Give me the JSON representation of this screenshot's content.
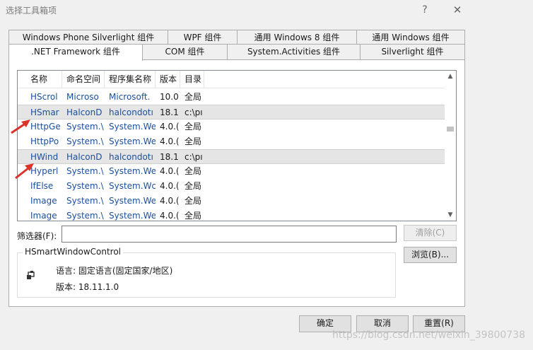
{
  "window": {
    "title": "选择工具箱项",
    "help_label": "?",
    "close_label": "✕"
  },
  "tabs": {
    "row1": [
      {
        "label": "Windows Phone Silverlight 组件"
      },
      {
        "label": "WPF 组件"
      },
      {
        "label": "通用 Windows 8 组件"
      },
      {
        "label": "通用 Windows 组件"
      }
    ],
    "row2": [
      {
        "label": ".NET Framework 组件",
        "active": true
      },
      {
        "label": "COM 组件"
      },
      {
        "label": "System.Activities 组件"
      },
      {
        "label": "Silverlight 组件"
      }
    ]
  },
  "list": {
    "columns": [
      "名称",
      "命名空间",
      "程序集名称",
      "版本",
      "目录"
    ],
    "rows": [
      {
        "name": "HScrol",
        "ns": "Microso",
        "asm": "Microsoft.",
        "ver": "10.0",
        "dir": "全局",
        "selected": false
      },
      {
        "name": "HSmar",
        "ns": "HalconD",
        "asm": "halcondotı",
        "ver": "18.1",
        "dir": "c:\\pı",
        "selected": true
      },
      {
        "name": "HttpGe",
        "ns": "System.\\",
        "asm": "System.We",
        "ver": "4.0.(",
        "dir": "全局",
        "selected": false
      },
      {
        "name": "HttpPo",
        "ns": "System.\\",
        "asm": "System.We",
        "ver": "4.0.(",
        "dir": "全局",
        "selected": false
      },
      {
        "name": "HWind",
        "ns": "HalconD",
        "asm": "halcondotı",
        "ver": "18.1",
        "dir": "c:\\pı",
        "selected": true
      },
      {
        "name": "Hyperl",
        "ns": "System.\\",
        "asm": "System.We",
        "ver": "4.0.(",
        "dir": "全局",
        "selected": false
      },
      {
        "name": "IfElse",
        "ns": "System.\\",
        "asm": "System.Wc",
        "ver": "4.0.(",
        "dir": "全局",
        "selected": false
      },
      {
        "name": "Image",
        "ns": "System.\\",
        "asm": "System.We",
        "ver": "4.0.(",
        "dir": "全局",
        "selected": false
      },
      {
        "name": "Image",
        "ns": "System.\\",
        "asm": "System.We",
        "ver": "4.0.(",
        "dir": "全局",
        "selected": false
      }
    ],
    "scroll_up_icon": "▲",
    "scroll_down_icon": "▼"
  },
  "filter": {
    "label": "筛选器(F):",
    "value": "",
    "clear_label": "清除(C)"
  },
  "details": {
    "group_title": "HSmartWindowControl",
    "language_line": "语言:  固定语言(固定国家/地区)",
    "version_line": "版本:  18.11.1.0",
    "browse_label": "浏览(B)..."
  },
  "footer": {
    "ok_label": "确定",
    "cancel_label": "取消",
    "reset_label": "重置(R)"
  },
  "watermark": "https://blog.csdn.net/weixin_39800738",
  "colors": {
    "accent_blue": "#1a4f9c",
    "annotation_red": "#d9342b",
    "window_bg": "#f0f0f0"
  }
}
